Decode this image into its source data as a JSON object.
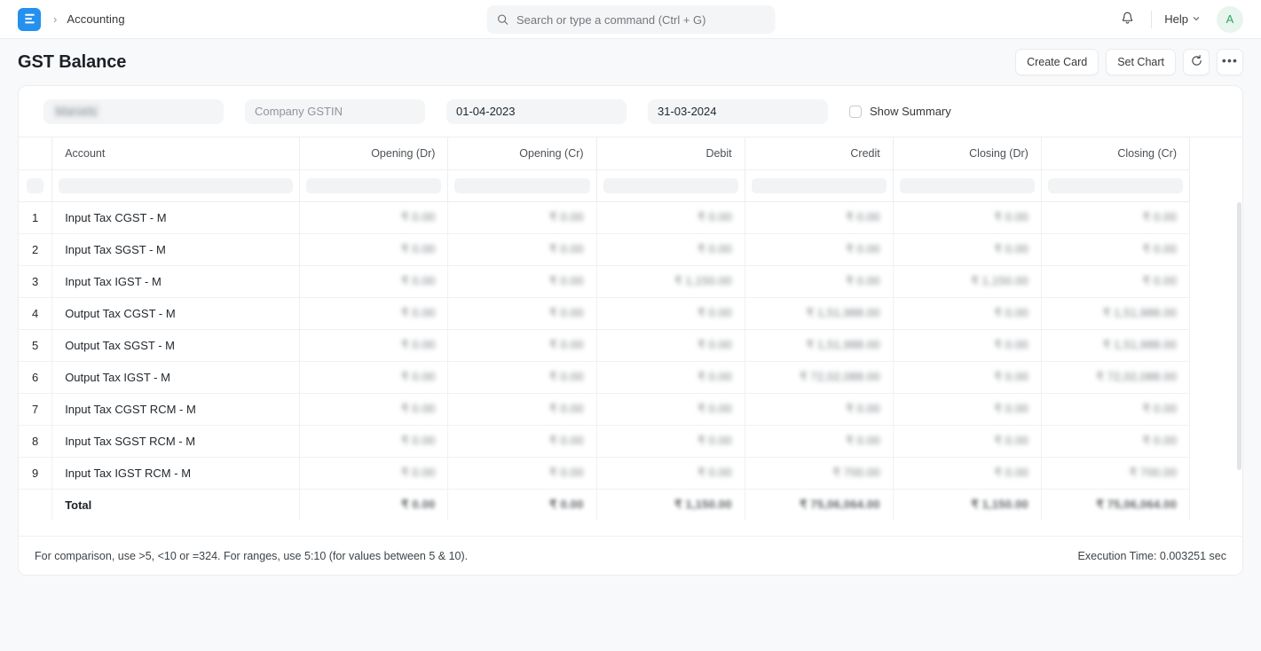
{
  "navbar": {
    "logo_icon": "frappe-books-logo",
    "breadcrumb_separator": "›",
    "breadcrumb": "Accounting",
    "search": {
      "icon": "search-icon",
      "placeholder": "Search or type a command (Ctrl + G)",
      "value": ""
    },
    "notifications_icon": "bell-icon",
    "help_label": "Help",
    "help_chevron_icon": "chevron-down-icon",
    "avatar_initial": "A"
  },
  "page": {
    "title": "GST Balance",
    "actions": {
      "create_card": "Create Card",
      "set_chart": "Set Chart",
      "refresh_icon": "refresh-icon",
      "more_icon": "ellipsis-icon"
    }
  },
  "filters": {
    "company": {
      "value": "Marvels",
      "redacted": true
    },
    "company_gstin": {
      "value": "",
      "placeholder": "Company GSTIN"
    },
    "from_date": {
      "value": "01-04-2023"
    },
    "to_date": {
      "value": "31-03-2024"
    },
    "show_summary": {
      "label": "Show Summary",
      "checked": false
    }
  },
  "table": {
    "columns": [
      "Account",
      "Opening (Dr)",
      "Opening (Cr)",
      "Debit",
      "Credit",
      "Closing (Dr)",
      "Closing (Cr)"
    ],
    "rows": [
      {
        "index": "1",
        "account": "Input Tax CGST - M",
        "opening_dr": "₹ 0.00",
        "opening_cr": "₹ 0.00",
        "debit": "₹ 0.00",
        "credit": "₹ 0.00",
        "closing_dr": "₹ 0.00",
        "closing_cr": "₹ 0.00"
      },
      {
        "index": "2",
        "account": "Input Tax SGST - M",
        "opening_dr": "₹ 0.00",
        "opening_cr": "₹ 0.00",
        "debit": "₹ 0.00",
        "credit": "₹ 0.00",
        "closing_dr": "₹ 0.00",
        "closing_cr": "₹ 0.00"
      },
      {
        "index": "3",
        "account": "Input Tax IGST - M",
        "opening_dr": "₹ 0.00",
        "opening_cr": "₹ 0.00",
        "debit": "₹ 1,150.00",
        "credit": "₹ 0.00",
        "closing_dr": "₹ 1,150.00",
        "closing_cr": "₹ 0.00"
      },
      {
        "index": "4",
        "account": "Output Tax CGST - M",
        "opening_dr": "₹ 0.00",
        "opening_cr": "₹ 0.00",
        "debit": "₹ 0.00",
        "credit": "₹ 1,51,988.00",
        "closing_dr": "₹ 0.00",
        "closing_cr": "₹ 1,51,988.00"
      },
      {
        "index": "5",
        "account": "Output Tax SGST - M",
        "opening_dr": "₹ 0.00",
        "opening_cr": "₹ 0.00",
        "debit": "₹ 0.00",
        "credit": "₹ 1,51,988.00",
        "closing_dr": "₹ 0.00",
        "closing_cr": "₹ 1,51,988.00"
      },
      {
        "index": "6",
        "account": "Output Tax IGST - M",
        "opening_dr": "₹ 0.00",
        "opening_cr": "₹ 0.00",
        "debit": "₹ 0.00",
        "credit": "₹ 72,02,088.00",
        "closing_dr": "₹ 0.00",
        "closing_cr": "₹ 72,02,088.00"
      },
      {
        "index": "7",
        "account": "Input Tax CGST RCM - M",
        "opening_dr": "₹ 0.00",
        "opening_cr": "₹ 0.00",
        "debit": "₹ 0.00",
        "credit": "₹ 0.00",
        "closing_dr": "₹ 0.00",
        "closing_cr": "₹ 0.00"
      },
      {
        "index": "8",
        "account": "Input Tax SGST RCM - M",
        "opening_dr": "₹ 0.00",
        "opening_cr": "₹ 0.00",
        "debit": "₹ 0.00",
        "credit": "₹ 0.00",
        "closing_dr": "₹ 0.00",
        "closing_cr": "₹ 0.00"
      },
      {
        "index": "9",
        "account": "Input Tax IGST RCM - M",
        "opening_dr": "₹ 0.00",
        "opening_cr": "₹ 0.00",
        "debit": "₹ 0.00",
        "credit": "₹ 700.00",
        "closing_dr": "₹ 0.00",
        "closing_cr": "₹ 700.00"
      }
    ],
    "total": {
      "label": "Total",
      "opening_dr": "₹ 0.00",
      "opening_cr": "₹ 0.00",
      "debit": "₹ 1,150.00",
      "credit": "₹ 75,06,064.00",
      "closing_dr": "₹ 1,150.00",
      "closing_cr": "₹ 75,06,064.00"
    },
    "values_redacted": true
  },
  "footer": {
    "hint": "For comparison, use >5, <10 or =324. For ranges, use 5:10 (for values between 5 & 10).",
    "execution_time": "Execution Time: 0.003251 sec"
  },
  "colors": {
    "accent": "#2490ef",
    "page_bg": "#f8f9fa",
    "card_bg": "#ffffff",
    "avatar_bg": "#e8f5ee",
    "avatar_text": "#29a867"
  }
}
